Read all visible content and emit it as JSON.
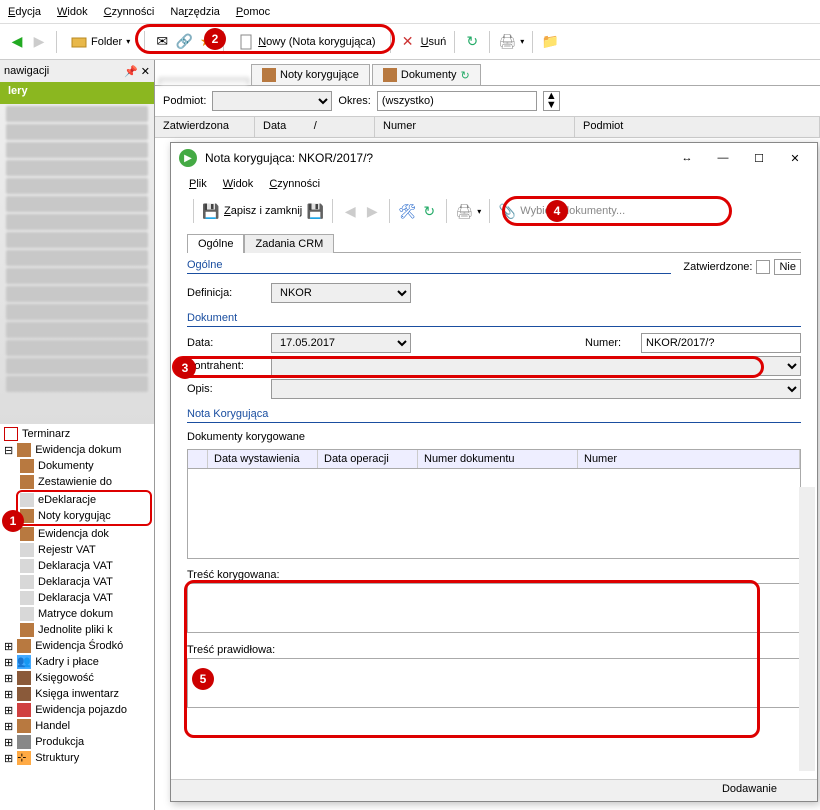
{
  "menubar": {
    "edycja": "Edycja",
    "widok": "Widok",
    "czynnosci": "Czynności",
    "narzedzia": "Narzędzia",
    "pomoc": "Pomoc"
  },
  "toolbar": {
    "folder_label": "Folder",
    "nowy_label": "Nowy (Nota korygująca)",
    "usun_label": "Usuń"
  },
  "nav": {
    "header": "nawigacji",
    "green": "lery",
    "tree": {
      "terminarz": "Terminarz",
      "ewidencja_dokum": "Ewidencja dokum",
      "dokumenty": "Dokumenty",
      "zestawienie": "Zestawienie do",
      "edeklaracje": "eDeklaracje",
      "noty_koryg": "Noty korygując",
      "ewidencja_dok": "Ewidencja dok",
      "rejestr_vat": "Rejestr VAT",
      "deklaracja_vat1": "Deklaracja VAT",
      "deklaracja_vat2": "Deklaracja VAT",
      "deklaracja_vat3": "Deklaracja VAT",
      "matryce": "Matryce dokum",
      "jednolite": "Jednolite pliki k",
      "ewidencja_srod": "Ewidencja Środkó",
      "kadry": "Kadry i płace",
      "ksiegowosc": "Księgowość",
      "ksiega_inw": "Księga inwentarz",
      "ewidencja_poj": "Ewidencja pojazdo",
      "handel": "Handel",
      "produkcja": "Produkcja",
      "struktury": "Struktury"
    }
  },
  "tabs_top": {
    "noty": "Noty korygujące",
    "dokumenty": "Dokumenty"
  },
  "filter": {
    "podmiot_label": "Podmiot:",
    "okres_label": "Okres:",
    "okres_value": "(wszystko)"
  },
  "grid": {
    "c1": "Zatwierdzona",
    "c2": "Data",
    "c3": "Numer",
    "c4": "Podmiot"
  },
  "dialog": {
    "title": "Nota korygująca: NKOR/2017/?",
    "menu": {
      "plik": "Plik",
      "widok": "Widok",
      "czynnosci": "Czynności"
    },
    "toolbar": {
      "zapisz": "Zapisz i zamknij",
      "wybierz": "Wybierz dokumenty..."
    },
    "tabs": {
      "ogolne": "Ogólne",
      "zadania": "Zadania CRM"
    },
    "section_ogolne": "Ogólne",
    "zatwierdzone_label": "Zatwierdzone:",
    "zatwierdzone_value": "Nie",
    "definicja_label": "Definicja:",
    "definicja_value": "NKOR",
    "section_dokument": "Dokument",
    "data_label": "Data:",
    "data_value": "17.05.2017",
    "numer_label": "Numer:",
    "numer_value": "NKOR/2017/?",
    "kontrahent_label": "Kontrahent:",
    "opis_label": "Opis:",
    "section_nota": "Nota Korygująca",
    "dokumenty_koryg": "Dokumenty korygowane",
    "gridcols": {
      "c0": "",
      "c1": "Data wystawienia",
      "c2": "Data operacji",
      "c3": "Numer dokumentu",
      "c4": "Numer"
    },
    "tresc_koryg": "Treść korygowana:",
    "tresc_praw": "Treść prawidłowa:",
    "status": "Dodawanie"
  },
  "badges": {
    "b1": "1",
    "b2": "2",
    "b3": "3",
    "b4": "4",
    "b5": "5"
  }
}
